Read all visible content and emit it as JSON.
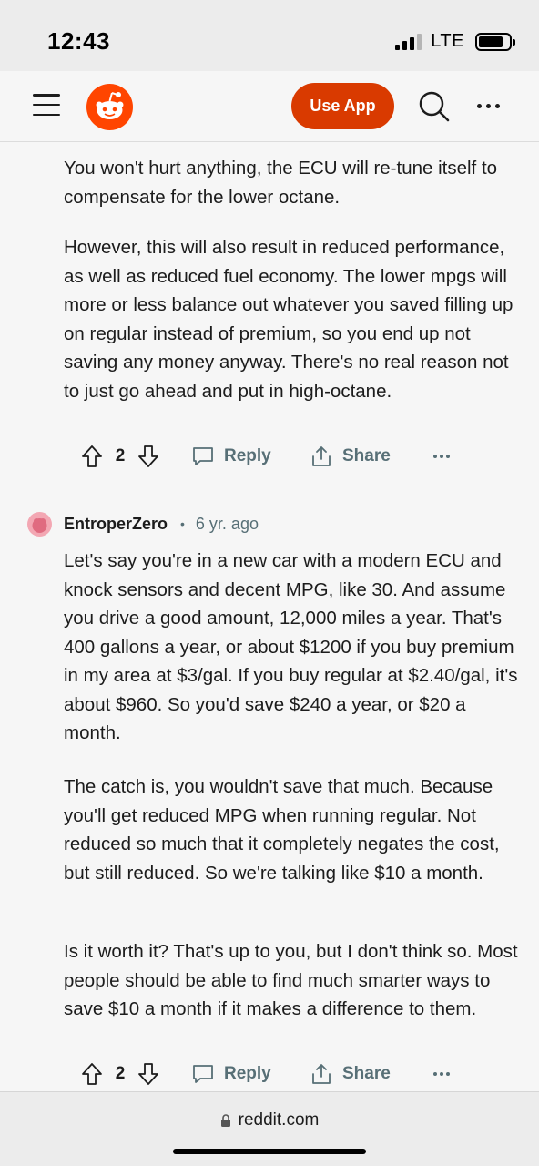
{
  "status_bar": {
    "time": "12:43",
    "network": "LTE"
  },
  "header": {
    "use_app_label": "Use App"
  },
  "comment1": {
    "paragraphs": [
      "You won't hurt anything, the ECU will re-tune itself to compensate for the lower octane.",
      "However, this will also result in reduced performance, as well as reduced fuel economy. The lower mpgs will more or less balance out whatever you saved filling up on regular instead of premium, so you end up not saving any money anyway. There's no real reason not to just go ahead and put in high-octane."
    ],
    "votes": "2"
  },
  "comment2": {
    "username": "EntroperZero",
    "separator": "•",
    "age": "6 yr. ago",
    "paragraphs": [
      "Let's say you're in a new car with a modern ECU and knock sensors and decent MPG, like 30. And assume you drive a good amount, 12,000 miles a year. That's 400 gallons a year, or about $1200 if you buy premium in my area at $3/gal. If you buy regular at $2.40/gal, it's about $960. So you'd save $240 a year, or $20 a month.",
      "The catch is, you wouldn't save that much. Because you'll get reduced MPG when running regular. Not reduced so much that it completely negates the cost, but still reduced. So we're talking like $10 a month.",
      "Is it worth it? That's up to you, but I don't think so. Most people should be able to find much smarter ways to save $10 a month if it makes a difference to them."
    ],
    "votes": "2"
  },
  "actions": {
    "reply_label": "Reply",
    "share_label": "Share"
  },
  "browser": {
    "url": "reddit.com"
  },
  "colors": {
    "brand": "#ff4500",
    "use_app_bg": "#d93a00",
    "meta_gray": "#576f76"
  },
  "icons": [
    "signal-icon",
    "battery-icon",
    "menu-icon",
    "reddit-logo",
    "search-icon",
    "more-icon",
    "upvote-icon",
    "downvote-icon",
    "reply-icon",
    "share-icon",
    "lock-icon"
  ]
}
